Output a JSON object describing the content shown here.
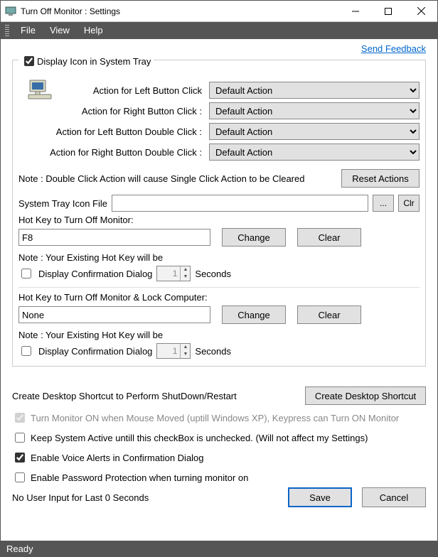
{
  "window": {
    "title": "Turn Off Monitor : Settings"
  },
  "menu": {
    "file": "File",
    "view": "View",
    "help": "Help"
  },
  "feedback": "Send Feedback",
  "tray": {
    "legend": "Display Icon in System Tray",
    "legend_checked": true,
    "actions": {
      "left_click_label": "Action for Left Button Click",
      "right_click_label": "Action for Right Button Click :",
      "left_dbl_label": "Action for Left Button Double Click :",
      "right_dbl_label": "Action for Right Button Double Click :",
      "left_click_value": "Default Action",
      "right_click_value": "Default Action",
      "left_dbl_value": "Default Action",
      "right_dbl_value": "Default Action"
    },
    "note": "Note : Double Click Action will cause Single Click Action to be Cleared",
    "reset_btn": "Reset Actions",
    "iconfile_label": "System Tray Icon File",
    "iconfile_value": "",
    "browse_btn": "...",
    "clr_btn": "Clr"
  },
  "hotkey1": {
    "title": "Hot Key to Turn Off Monitor:",
    "value": "F8",
    "change": "Change",
    "clear": "Clear",
    "note": "Note : Your Existing Hot Key will be",
    "confirm_label": "Display Confirmation Dialog",
    "confirm_checked": false,
    "seconds_value": "1",
    "seconds_label": "Seconds"
  },
  "hotkey2": {
    "title": "Hot Key to Turn Off Monitor & Lock Computer:",
    "value": "None",
    "change": "Change",
    "clear": "Clear",
    "note": "Note : Your Existing Hot Key will be",
    "confirm_label": "Display Confirmation Dialog",
    "confirm_checked": false,
    "seconds_value": "1",
    "seconds_label": "Seconds"
  },
  "shortcut": {
    "label": "Create Desktop Shortcut to Perform ShutDown/Restart",
    "button": "Create Desktop Shortcut"
  },
  "checks": {
    "turn_on_mouse": "Turn Monitor ON when Mouse Moved (uptill Windows XP), Keypress can Turn ON Monitor",
    "turn_on_mouse_checked": true,
    "keep_active": "Keep System Active untill this checkBox is unchecked.  (Will not affect my Settings)",
    "keep_active_checked": false,
    "voice_alerts": "Enable Voice Alerts in Confirmation Dialog",
    "voice_alerts_checked": true,
    "password": "Enable Password Protection when turning monitor on",
    "password_checked": false
  },
  "bottom": {
    "info": "No User Input for Last 0 Seconds",
    "save": "Save",
    "cancel": "Cancel"
  },
  "status": "Ready"
}
